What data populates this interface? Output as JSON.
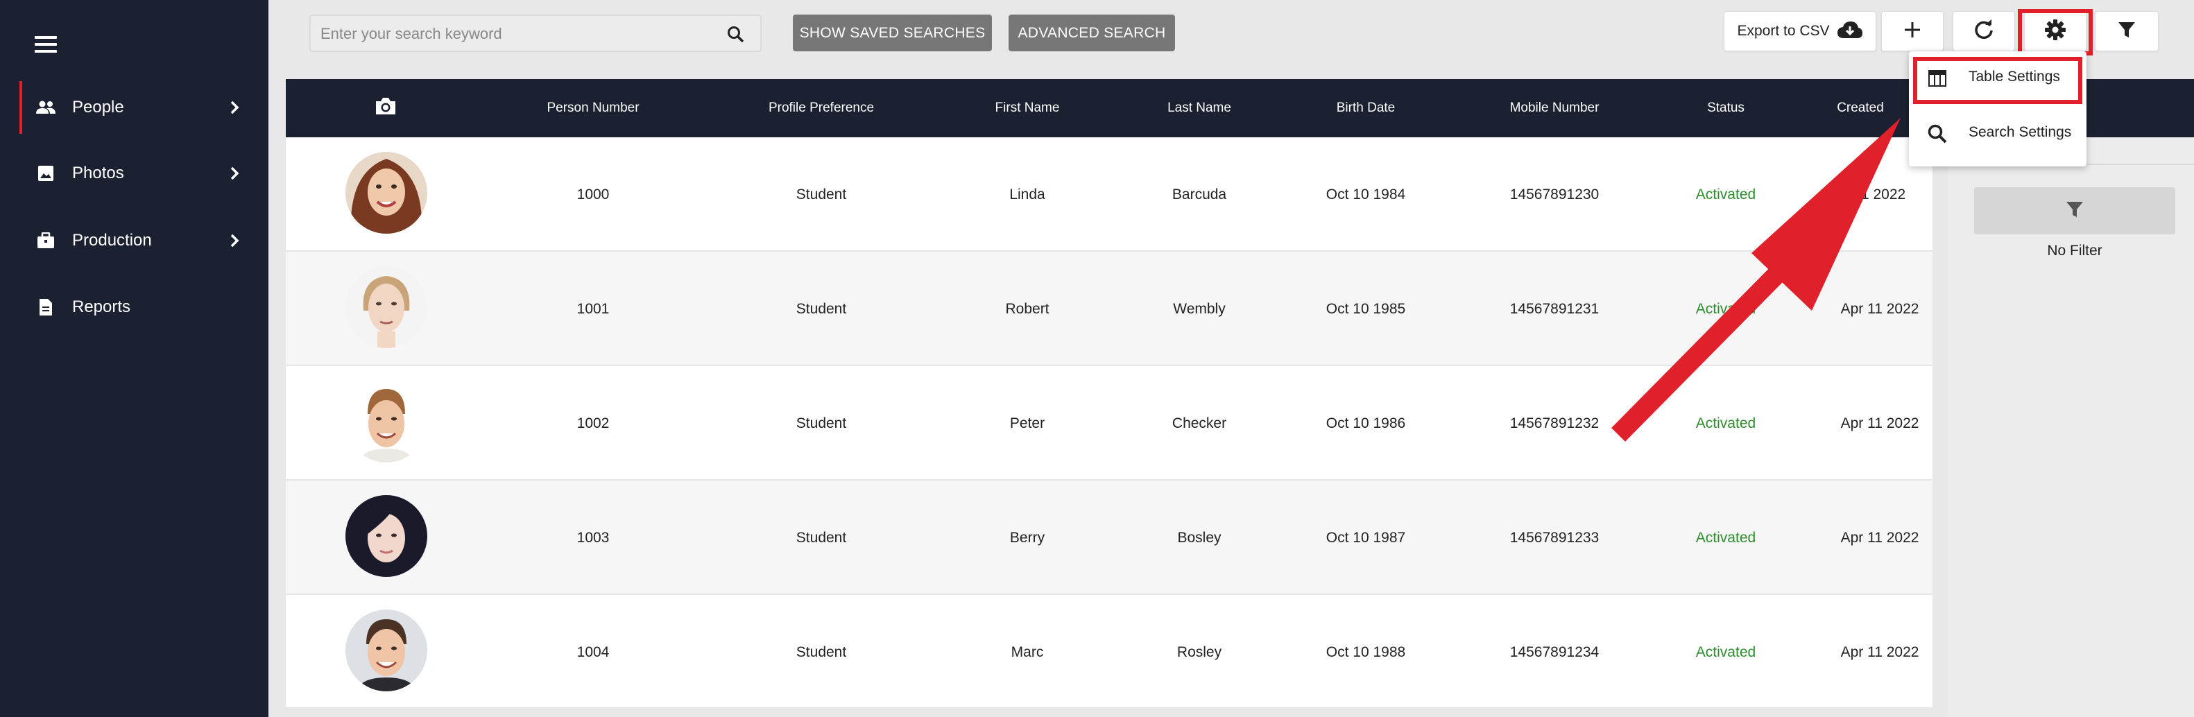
{
  "sidebar": {
    "items": [
      {
        "label": "People",
        "icon": "people-icon",
        "has_chevron": true,
        "active": true
      },
      {
        "label": "Photos",
        "icon": "photo-icon",
        "has_chevron": true,
        "active": false
      },
      {
        "label": "Production",
        "icon": "briefcase-icon",
        "has_chevron": true,
        "active": false
      },
      {
        "label": "Reports",
        "icon": "document-icon",
        "has_chevron": false,
        "active": false
      }
    ]
  },
  "toolbar": {
    "search_placeholder": "Enter your search keyword",
    "search_value": "",
    "show_saved_label": "SHOW SAVED SEARCHES",
    "advanced_label": "ADVANCED SEARCH",
    "export_label": "Export to CSV"
  },
  "colors": {
    "sidebar_bg": "#1b2130",
    "accent_red": "#e0202a",
    "status_green": "#2e8b2e",
    "button_grey": "#777777"
  },
  "table": {
    "columns": [
      "Person Number",
      "Profile Preference",
      "First Name",
      "Last Name",
      "Birth Date",
      "Mobile Number",
      "Status",
      "Created"
    ],
    "photo_column_icon": "camera-icon",
    "rows": [
      {
        "person_number": "1000",
        "profile": "Student",
        "first": "Linda",
        "last": "Barcuda",
        "birth": "Oct 10 1984",
        "mobile": "14567891230",
        "status": "Activated",
        "created": "11 2022"
      },
      {
        "person_number": "1001",
        "profile": "Student",
        "first": "Robert",
        "last": "Wembly",
        "birth": "Oct 10 1985",
        "mobile": "14567891231",
        "status": "Activated",
        "created": "Apr 11 2022"
      },
      {
        "person_number": "1002",
        "profile": "Student",
        "first": "Peter",
        "last": "Checker",
        "birth": "Oct 10 1986",
        "mobile": "14567891232",
        "status": "Activated",
        "created": "Apr 11 2022"
      },
      {
        "person_number": "1003",
        "profile": "Student",
        "first": "Berry",
        "last": "Bosley",
        "birth": "Oct 10 1987",
        "mobile": "14567891233",
        "status": "Activated",
        "created": "Apr 11 2022"
      },
      {
        "person_number": "1004",
        "profile": "Student",
        "first": "Marc",
        "last": "Rosley",
        "birth": "Oct 10 1988",
        "mobile": "14567891234",
        "status": "Activated",
        "created": "Apr 11 2022"
      }
    ]
  },
  "settings_menu": {
    "items": [
      {
        "label": "Table Settings",
        "icon": "table-icon",
        "highlighted": true
      },
      {
        "label": "Search Settings",
        "icon": "search-icon",
        "highlighted": false
      }
    ]
  },
  "filter_panel": {
    "no_filter_label": "No Filter"
  }
}
